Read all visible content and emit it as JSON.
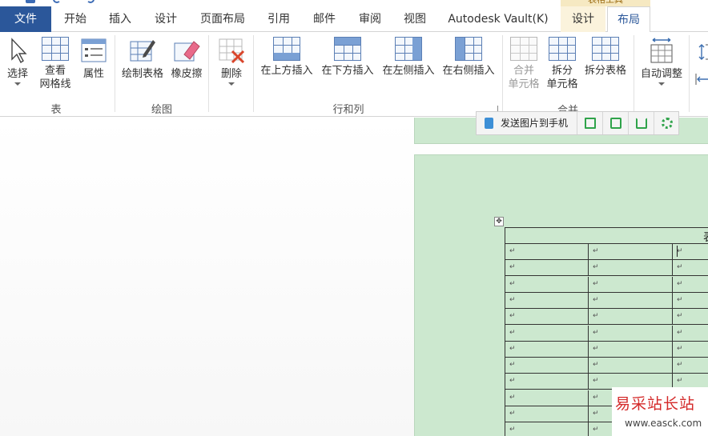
{
  "tabs": {
    "file": "文件",
    "home": "开始",
    "insert": "插入",
    "design": "设计",
    "page_layout": "页面布局",
    "references": "引用",
    "mailings": "邮件",
    "review": "审阅",
    "view": "视图",
    "vault": "Autodesk Vault(K)",
    "table_tools_group": "表格工具",
    "table_design": "设计",
    "table_layout": "布局"
  },
  "ribbon": {
    "table_group": {
      "label": "表",
      "select": "选择",
      "view_gridlines_1": "查看",
      "view_gridlines_2": "网格线",
      "properties": "属性"
    },
    "draw_group": {
      "label": "绘图",
      "draw_table": "绘制表格",
      "eraser": "橡皮擦"
    },
    "rows_cols_group": {
      "label": "行和列",
      "delete": "删除",
      "insert_above": "在上方插入",
      "insert_below": "在下方插入",
      "insert_left": "在左侧插入",
      "insert_right": "在右侧插入"
    },
    "merge_group": {
      "label": "合并",
      "merge_cells_1": "合并",
      "merge_cells_2": "单元格",
      "split_cells_1": "拆分",
      "split_cells_2": "单元格",
      "split_table": "拆分表格"
    },
    "cell_size_group": {
      "autofit": "自动调整"
    }
  },
  "floating_toolbar": {
    "send_to_phone": "发送图片到手机"
  },
  "document": {
    "table_header_partial": "表",
    "cell_mark": "↵",
    "row_count": 12
  },
  "watermark": {
    "title": "易采站长站",
    "url": "www.easck.com"
  },
  "colors": {
    "file_tab": "#2b579a",
    "page_background": "#cce8cf",
    "context_tab": "#f6e9c2",
    "accent_green": "#2fa34a"
  }
}
